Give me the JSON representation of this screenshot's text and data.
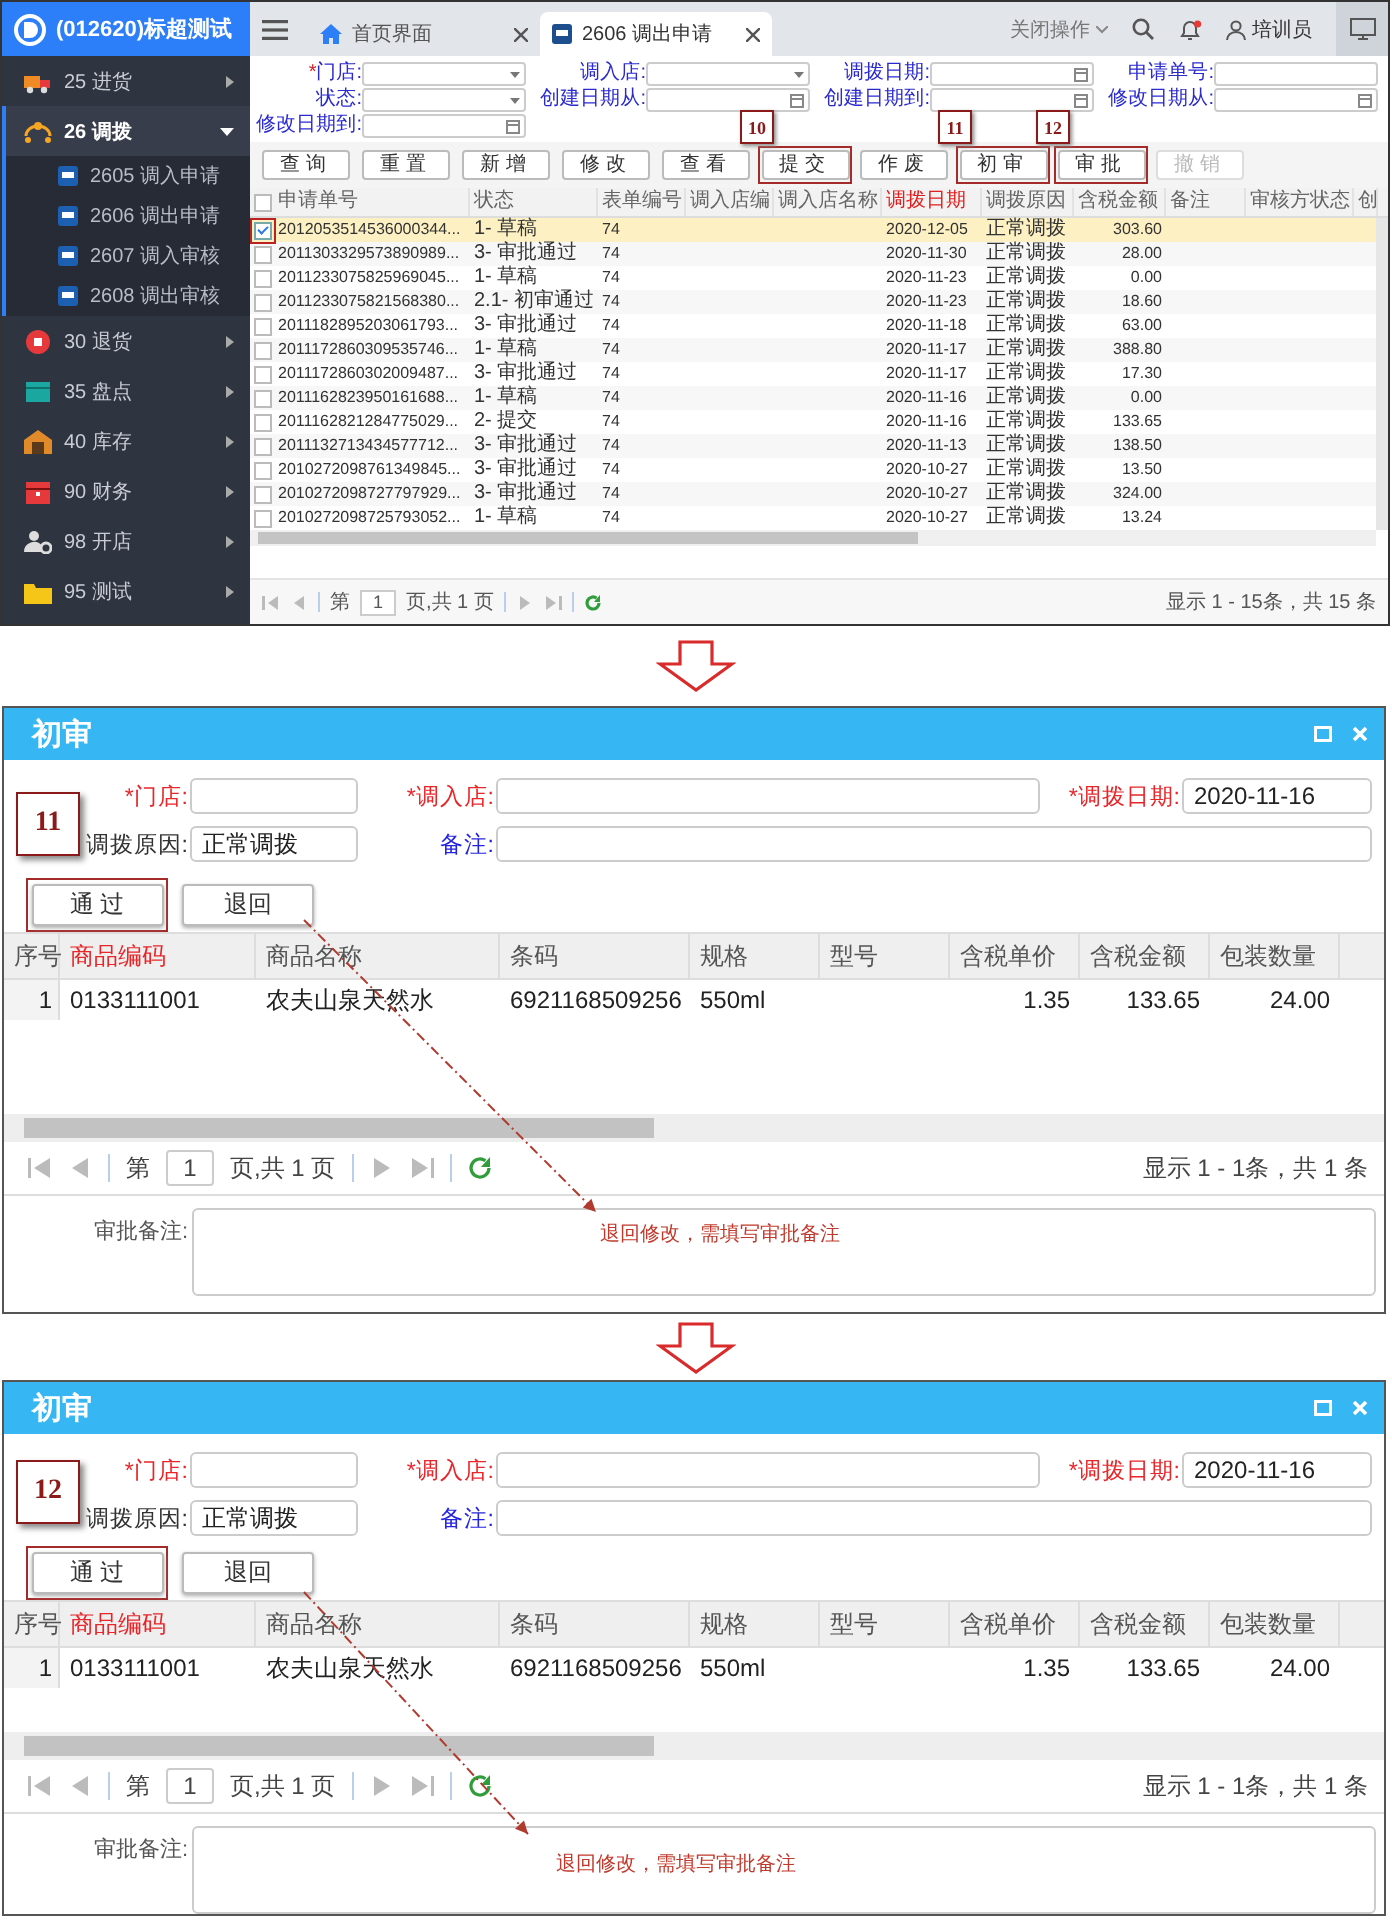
{
  "main_window": {
    "brand": "(012620)标超测试",
    "sidebar": {
      "items": [
        {
          "label": "25 进货",
          "selected": false,
          "expanded": false
        },
        {
          "label": "26 调拨",
          "selected": true,
          "expanded": true,
          "children": [
            {
              "label": "2605 调入申请"
            },
            {
              "label": "2606 调出申请"
            },
            {
              "label": "2607 调入审核"
            },
            {
              "label": "2608 调出审核"
            }
          ]
        },
        {
          "label": "30 退货",
          "selected": false,
          "expanded": false
        },
        {
          "label": "35 盘点",
          "selected": false,
          "expanded": false
        },
        {
          "label": "40 库存",
          "selected": false,
          "expanded": false
        },
        {
          "label": "90 财务",
          "selected": false,
          "expanded": false
        },
        {
          "label": "98 开店",
          "selected": false,
          "expanded": false
        },
        {
          "label": "95 测试",
          "selected": false,
          "expanded": false
        }
      ]
    },
    "tabs": [
      {
        "label": "首页界面",
        "selected": false
      },
      {
        "label": "2606 调出申请",
        "selected": true
      }
    ],
    "header": {
      "close_menu": "关闭操作",
      "user": "培训员",
      "notification": true
    },
    "filters": [
      {
        "label": "门店:",
        "required_mark": "*",
        "kind": "select"
      },
      {
        "label": "调入店:",
        "kind": "select"
      },
      {
        "label": "调拨日期:",
        "kind": "date"
      },
      {
        "label": "申请单号:",
        "kind": "text"
      },
      {
        "label": "状态:",
        "kind": "select"
      },
      {
        "label": "创建日期从:",
        "kind": "date"
      },
      {
        "label": "创建日期到:",
        "kind": "date"
      },
      {
        "label": "修改日期从:",
        "kind": "date"
      },
      {
        "label": "修改日期到:",
        "kind": "date"
      }
    ],
    "toolbar": [
      {
        "label": "查询",
        "disabled": false
      },
      {
        "label": "重置",
        "disabled": false
      },
      {
        "label": "新增",
        "disabled": false
      },
      {
        "label": "修改",
        "disabled": false
      },
      {
        "label": "查看",
        "disabled": false
      },
      {
        "label": "提交",
        "disabled": false,
        "callout": "10"
      },
      {
        "label": "作废",
        "disabled": false
      },
      {
        "label": "初审",
        "disabled": false,
        "callout": "11"
      },
      {
        "label": "审批",
        "disabled": false,
        "callout": "12"
      },
      {
        "label": "撤销",
        "disabled": true
      }
    ],
    "table": {
      "all_checked": false,
      "columns": [
        {
          "label": "申请单号",
          "required": false
        },
        {
          "label": "状态",
          "required": false
        },
        {
          "label": "表单编号",
          "required": false
        },
        {
          "label": "调入店编",
          "required": false
        },
        {
          "label": "调入店名称",
          "required": false
        },
        {
          "label": "调拨日期",
          "required": true
        },
        {
          "label": "调拨原因",
          "required": false
        },
        {
          "label": "含税金额",
          "required": false
        },
        {
          "label": "备注",
          "required": false
        },
        {
          "label": "审核方状态",
          "required": false
        },
        {
          "label": "创",
          "required": false
        }
      ],
      "rows": [
        {
          "selected": true,
          "number": "2012053514536000344...",
          "status": "1- 草稿",
          "form_no": "74",
          "date": "2020-12-05",
          "reason": "正常调拨",
          "amount": "303.60"
        },
        {
          "selected": false,
          "number": "2011303329573890989...",
          "status": "3- 审批通过",
          "form_no": "74",
          "date": "2020-11-30",
          "reason": "正常调拨",
          "amount": "28.00"
        },
        {
          "selected": false,
          "number": "2011233075825969045...",
          "status": "1- 草稿",
          "form_no": "74",
          "date": "2020-11-23",
          "reason": "正常调拨",
          "amount": "0.00"
        },
        {
          "selected": false,
          "number": "2011233075821568380...",
          "status": "2.1- 初审通过",
          "form_no": "74",
          "date": "2020-11-23",
          "reason": "正常调拨",
          "amount": "18.60"
        },
        {
          "selected": false,
          "number": "2011182895203061793...",
          "status": "3- 审批通过",
          "form_no": "74",
          "date": "2020-11-18",
          "reason": "正常调拨",
          "amount": "63.00"
        },
        {
          "selected": false,
          "number": "2011172860309535746...",
          "status": "1- 草稿",
          "form_no": "74",
          "date": "2020-11-17",
          "reason": "正常调拨",
          "amount": "388.80"
        },
        {
          "selected": false,
          "number": "2011172860302009487...",
          "status": "3- 审批通过",
          "form_no": "74",
          "date": "2020-11-17",
          "reason": "正常调拨",
          "amount": "17.30"
        },
        {
          "selected": false,
          "number": "2011162823950161688...",
          "status": "1- 草稿",
          "form_no": "74",
          "date": "2020-11-16",
          "reason": "正常调拨",
          "amount": "0.00"
        },
        {
          "selected": false,
          "number": "2011162821284775029...",
          "status": "2- 提交",
          "form_no": "74",
          "date": "2020-11-16",
          "reason": "正常调拨",
          "amount": "133.65"
        },
        {
          "selected": false,
          "number": "2011132713434577712...",
          "status": "3- 审批通过",
          "form_no": "74",
          "date": "2020-11-13",
          "reason": "正常调拨",
          "amount": "138.50"
        },
        {
          "selected": false,
          "number": "2010272098761349845...",
          "status": "3- 审批通过",
          "form_no": "74",
          "date": "2020-10-27",
          "reason": "正常调拨",
          "amount": "13.50"
        },
        {
          "selected": false,
          "number": "2010272098727797929...",
          "status": "3- 审批通过",
          "form_no": "74",
          "date": "2020-10-27",
          "reason": "正常调拨",
          "amount": "324.00"
        },
        {
          "selected": false,
          "number": "2010272098725793052...",
          "status": "1- 草稿",
          "form_no": "74",
          "date": "2020-10-27",
          "reason": "正常调拨",
          "amount": "13.24"
        }
      ]
    },
    "pager": {
      "before": "第",
      "page": "1",
      "after": "页,共 1 页",
      "summary": "显示 1 - 15条，共 15 条"
    }
  },
  "dialogs": [
    {
      "title": "初审",
      "form_rows": [
        [
          {
            "label": "*门店:",
            "kind": "required"
          },
          {
            "label": "*调入店:",
            "kind": "required"
          },
          {
            "label": "*调拨日期:",
            "kind": "required",
            "value": "2020-11-16"
          }
        ],
        [
          {
            "label": "调拨原因:",
            "kind": "plain",
            "value": "正常调拨"
          },
          {
            "label": "备注:",
            "kind": "info"
          }
        ]
      ],
      "buttons": [
        {
          "label": "通 过",
          "callout": "11"
        },
        {
          "label": "退回"
        }
      ],
      "table": {
        "columns": [
          {
            "label": "序号",
            "required": false
          },
          {
            "label": "商品编码",
            "required": true
          },
          {
            "label": "商品名称",
            "required": false
          },
          {
            "label": "条码",
            "required": false
          },
          {
            "label": "规格",
            "required": false
          },
          {
            "label": "型号",
            "required": false
          },
          {
            "label": "含税单价",
            "required": false
          },
          {
            "label": "含税金额",
            "required": false
          },
          {
            "label": "包装数量",
            "required": false
          }
        ],
        "rows": [
          {
            "index": "1",
            "code": "0133111001",
            "name": "农夫山泉天然水",
            "barcode": "6921168509256",
            "spec": "550ml",
            "unit_price": "1.35",
            "amount": "133.65",
            "pack_qty": "24.00"
          }
        ]
      },
      "pager": {
        "before": "第",
        "page": "1",
        "after": "页,共 1 页",
        "summary": "显示 1 - 1条，共 1 条"
      },
      "remark_label": "审批备注:",
      "annotation": "退回修改，需填写审批备注"
    },
    {
      "title": "初审",
      "form_rows": [
        [
          {
            "label": "*门店:",
            "kind": "required"
          },
          {
            "label": "*调入店:",
            "kind": "required"
          },
          {
            "label": "*调拨日期:",
            "kind": "required",
            "value": "2020-11-16"
          }
        ],
        [
          {
            "label": "调拨原因:",
            "kind": "plain",
            "value": "正常调拨"
          },
          {
            "label": "备注:",
            "kind": "info"
          }
        ]
      ],
      "buttons": [
        {
          "label": "通 过",
          "callout": "12"
        },
        {
          "label": "退回"
        }
      ],
      "table": {
        "columns": [
          {
            "label": "序号",
            "required": false
          },
          {
            "label": "商品编码",
            "required": true
          },
          {
            "label": "商品名称",
            "required": false
          },
          {
            "label": "条码",
            "required": false
          },
          {
            "label": "规格",
            "required": false
          },
          {
            "label": "型号",
            "required": false
          },
          {
            "label": "含税单价",
            "required": false
          },
          {
            "label": "含税金额",
            "required": false
          },
          {
            "label": "包装数量",
            "required": false
          }
        ],
        "rows": [
          {
            "index": "1",
            "code": "0133111001",
            "name": "农夫山泉天然水",
            "barcode": "6921168509256",
            "spec": "550ml",
            "unit_price": "1.35",
            "amount": "133.65",
            "pack_qty": "24.00"
          }
        ]
      },
      "pager": {
        "before": "第",
        "page": "1",
        "after": "页,共 1 页",
        "summary": "显示 1 - 1条，共 1 条"
      },
      "remark_label": "审批备注:",
      "annotation": "退回修改，需填写审批备注"
    }
  ]
}
